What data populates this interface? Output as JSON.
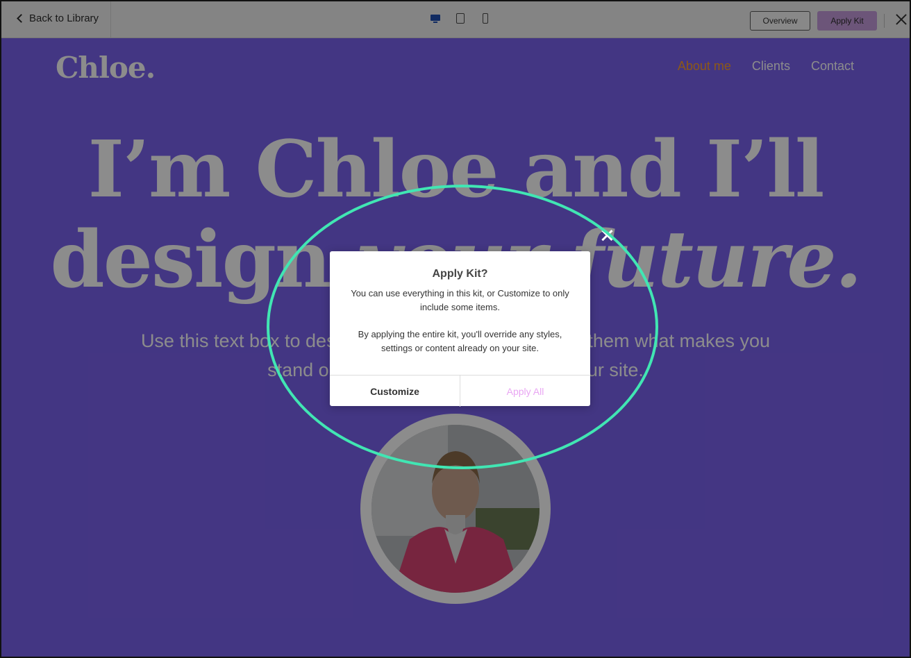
{
  "topbar": {
    "back_label": "Back to Library",
    "devices": [
      {
        "icon": "desktop-icon",
        "active": true
      },
      {
        "icon": "tablet-icon",
        "active": false
      },
      {
        "icon": "mobile-icon",
        "active": false
      }
    ],
    "overview_label": "Overview",
    "apply_kit_label": "Apply Kit",
    "close_icon": "close-icon"
  },
  "site": {
    "logo": "Chloe.",
    "nav": [
      "About me",
      "Clients",
      "Contact"
    ],
    "nav_active": "About me",
    "hero_line1": "I’m Chloe and I’ll",
    "hero_line2_a": "design ",
    "hero_line2_b": "your future.",
    "subtext": "Use this text box to describe what you're offering. Tell them what makes you stand out and showcase content on your site.",
    "colors": {
      "background": "#7b63ef",
      "nav_active": "#ffa02b",
      "text": "#ffffff"
    }
  },
  "modal": {
    "title": "Apply Kit?",
    "text1": "You can use everything in this kit, or Customize to only include some items.",
    "text2": "By applying the entire kit, you'll override any styles, settings or content already on your site.",
    "customize_label": "Customize",
    "apply_all_label": "Apply All",
    "close_icon": "close-icon"
  },
  "annotation": {
    "color": "#41e6b3",
    "shape": "ellipse"
  }
}
